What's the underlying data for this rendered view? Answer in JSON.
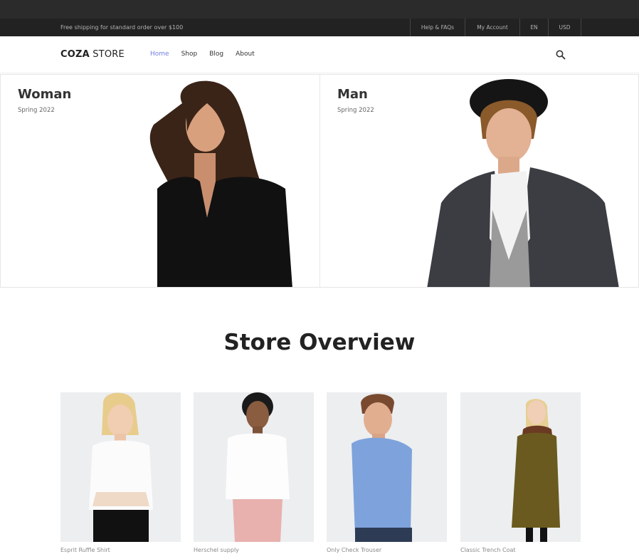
{
  "topbar": {
    "promo": "Free shipping for standard order over $100",
    "links": [
      "Help & FAQs",
      "My Account",
      "EN",
      "USD"
    ]
  },
  "header": {
    "logo_bold": "COZA",
    "logo_light": "STORE",
    "nav": [
      "Home",
      "Shop",
      "Blog",
      "About"
    ],
    "active_nav": "Home",
    "accent_color": "#717fe0"
  },
  "banners": [
    {
      "title": "Woman",
      "subtitle": "Spring 2022"
    },
    {
      "title": "Man",
      "subtitle": "Spring 2022"
    }
  ],
  "overview": {
    "title": "Store Overview"
  },
  "products": [
    {
      "name": "Esprit Ruffle Shirt"
    },
    {
      "name": "Herschel supply"
    },
    {
      "name": "Only Check Trouser"
    },
    {
      "name": "Classic Trench Coat"
    }
  ]
}
